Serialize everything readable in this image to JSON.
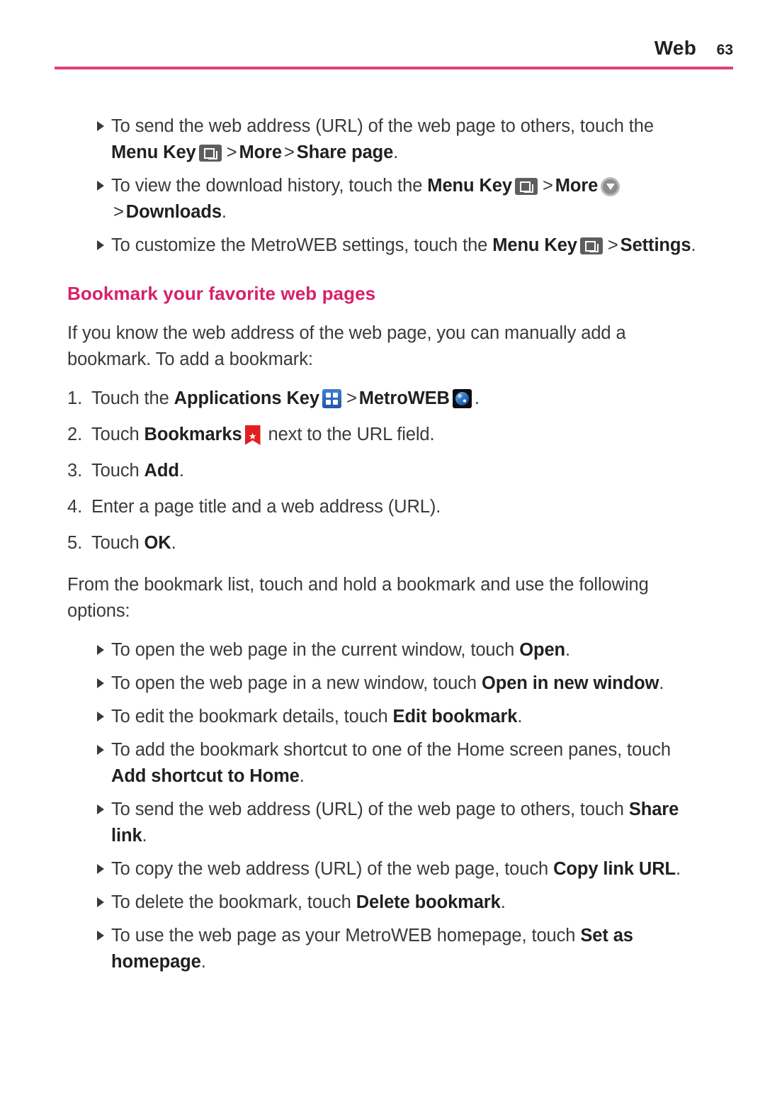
{
  "header": {
    "title": "Web",
    "page_number": "63",
    "rule_color": "#e0407e"
  },
  "colors": {
    "heading_pink": "#d6216a",
    "body_text": "#3a3a3a",
    "bold_text": "#231f20"
  },
  "icons": {
    "menu_key": "menu-key-icon",
    "downloads": "downloads-icon",
    "applications_key": "applications-key-icon",
    "metroweb": "metroweb-globe-icon",
    "bookmarks": "bookmarks-ribbon-icon",
    "bullet": "bullet-arrow-icon"
  },
  "top_bullets": [
    {
      "seg1": "To send the web address (URL) of the web page to others, touch the ",
      "bold1": "Menu Key",
      "sep1": ">",
      "bold2": "More",
      "sep2": ">",
      "bold3": "Share page",
      "tail": "."
    },
    {
      "seg1": "To view the download history, touch the ",
      "bold1": "Menu Key",
      "sep1": ">",
      "bold2": "More",
      "sep2": ">",
      "bold3": "Downloads",
      "tail": "."
    },
    {
      "seg1": "To customize the MetroWEB settings, touch the ",
      "bold1": "Menu Key",
      "sep1": ">",
      "bold2": "Settings",
      "tail": "."
    }
  ],
  "section": {
    "heading": "Bookmark your favorite web pages",
    "intro": "If you know the web address of the web page, you can manually add a bookmark. To add a bookmark:"
  },
  "steps": [
    {
      "num": "1.",
      "seg1": "Touch the ",
      "bold1": "Applications Key",
      "sep1": ">",
      "bold2": "MetroWEB",
      "tail": "."
    },
    {
      "num": "2.",
      "seg1": "Touch ",
      "bold1": "Bookmarks",
      "tail": " next to the URL field."
    },
    {
      "num": "3.",
      "seg1": "Touch ",
      "bold1": "Add",
      "tail": "."
    },
    {
      "num": "4.",
      "seg1": "Enter a page title and a web address (URL).",
      "bold1": "",
      "tail": ""
    },
    {
      "num": "5.",
      "seg1": "Touch ",
      "bold1": "OK",
      "tail": "."
    }
  ],
  "options_intro": "From the bookmark list, touch and hold a bookmark and use the following options:",
  "option_bullets": [
    {
      "seg1": "To open the web page in the current window, touch ",
      "bold1": "Open",
      "tail": "."
    },
    {
      "seg1": "To open the web page in a new window, touch ",
      "bold1": "Open in new window",
      "tail": "."
    },
    {
      "seg1": "To edit the bookmark details, touch ",
      "bold1": "Edit bookmark",
      "tail": "."
    },
    {
      "seg1": "To add the bookmark shortcut to one of the Home screen panes, touch ",
      "bold1": "Add shortcut to Home",
      "tail": "."
    },
    {
      "seg1": "To send the web address (URL) of the web page to others, touch ",
      "bold1": "Share link",
      "tail": "."
    },
    {
      "seg1": "To copy the web address (URL) of the web page, touch ",
      "bold1": "Copy link URL",
      "tail": "."
    },
    {
      "seg1": "To delete the bookmark, touch ",
      "bold1": "Delete bookmark",
      "tail": "."
    },
    {
      "seg1": "To use the web page as your MetroWEB homepage, touch ",
      "bold1": "Set as homepage",
      "tail": "."
    }
  ]
}
